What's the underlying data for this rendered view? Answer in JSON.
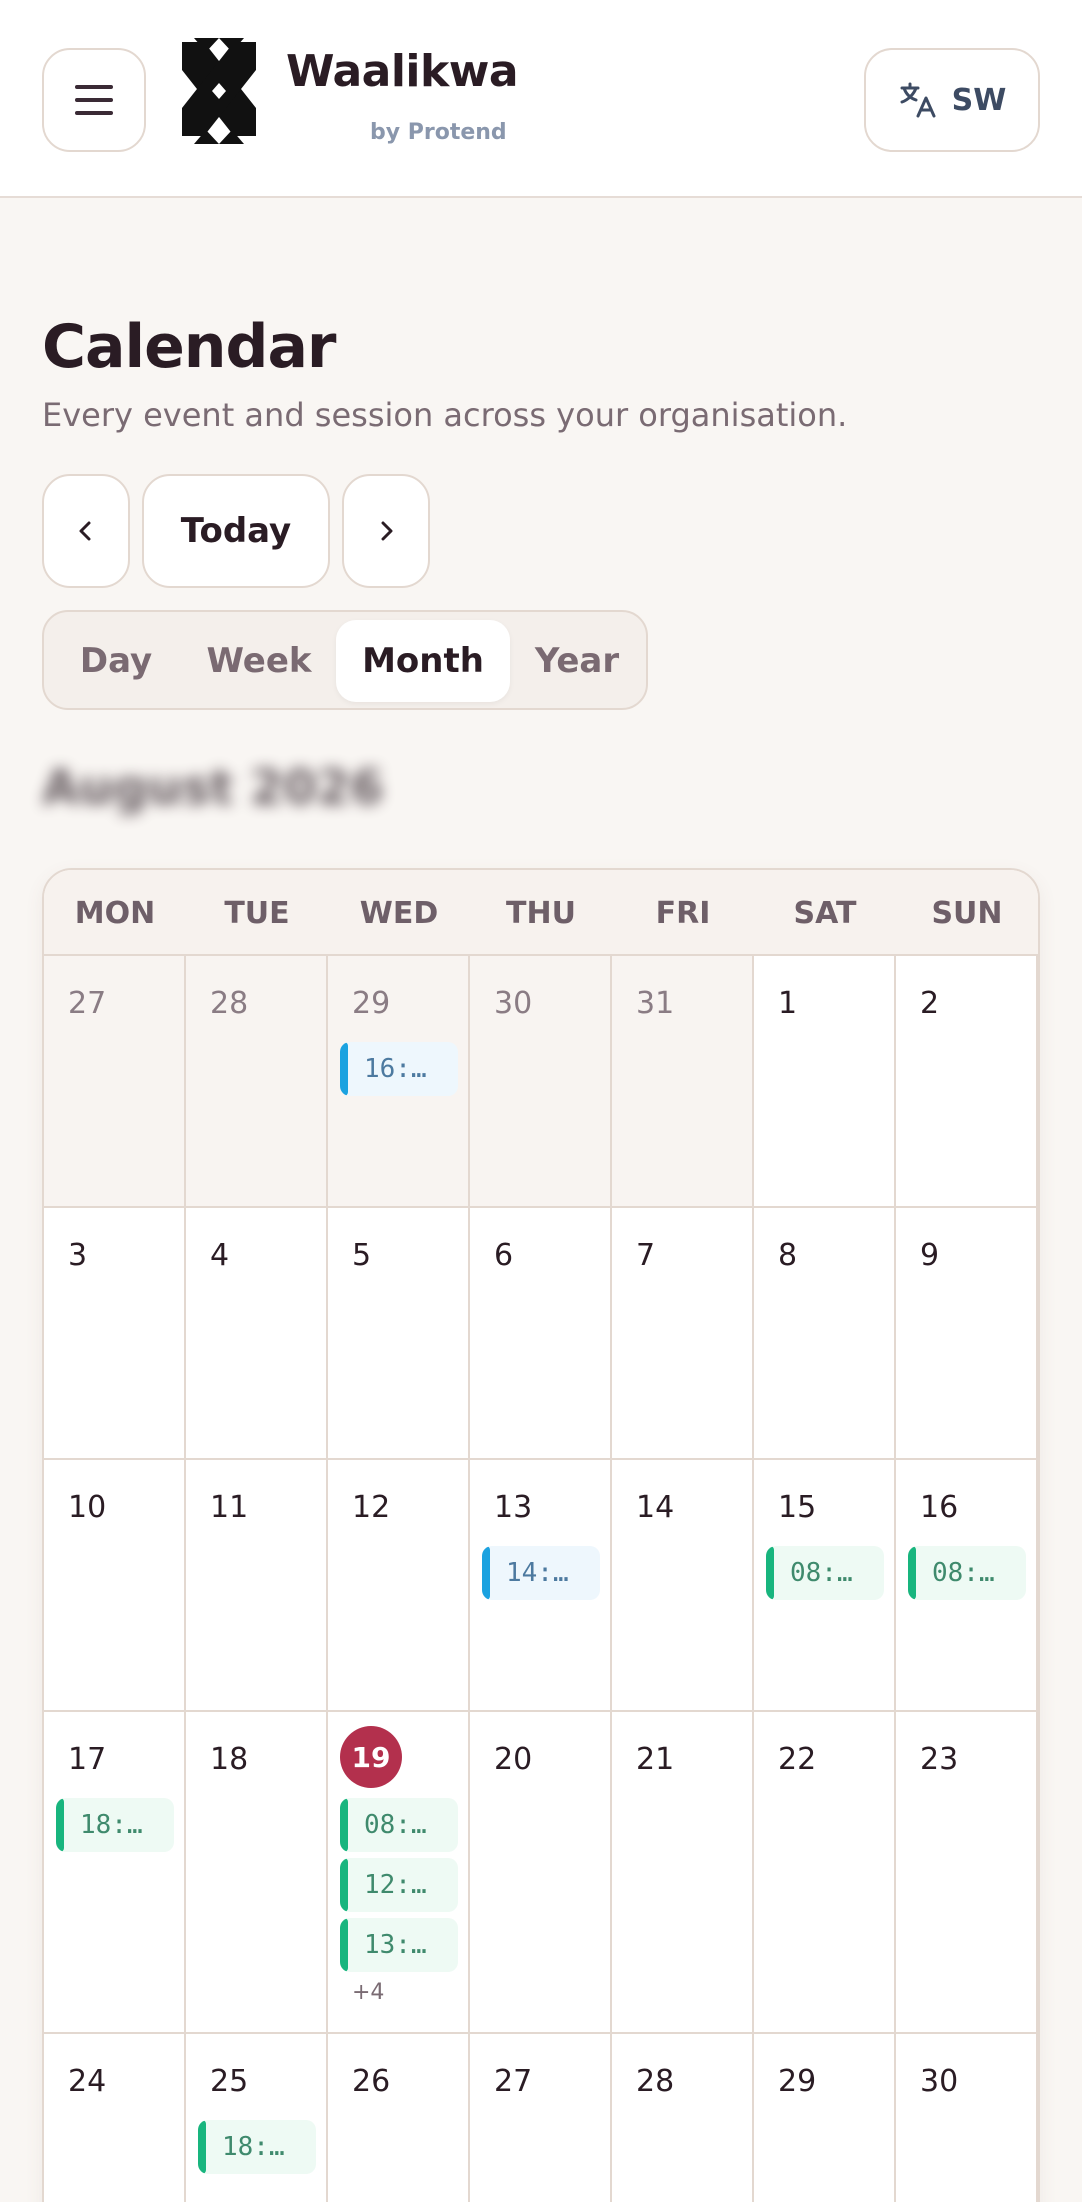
{
  "header": {
    "brand": "Waalikwa",
    "brand_sub": "by Protend",
    "lang_code": "SW"
  },
  "page": {
    "title": "Calendar",
    "subtitle": "Every event and session across your organisation.",
    "today_label": "Today",
    "month_label": "August 2026"
  },
  "views": [
    "Day",
    "Week",
    "Month",
    "Year"
  ],
  "active_view": "Month",
  "weekdays": [
    "MON",
    "TUE",
    "WED",
    "THU",
    "FRI",
    "SAT",
    "SUN"
  ],
  "weeks": [
    [
      {
        "day": "27",
        "muted": true,
        "events": []
      },
      {
        "day": "28",
        "muted": true,
        "events": []
      },
      {
        "day": "29",
        "muted": true,
        "events": [
          {
            "label": "16:…",
            "color": "blue"
          }
        ]
      },
      {
        "day": "30",
        "muted": true,
        "events": []
      },
      {
        "day": "31",
        "muted": true,
        "events": []
      },
      {
        "day": "1",
        "muted": false,
        "events": []
      },
      {
        "day": "2",
        "muted": false,
        "events": []
      }
    ],
    [
      {
        "day": "3",
        "muted": false,
        "events": []
      },
      {
        "day": "4",
        "muted": false,
        "events": []
      },
      {
        "day": "5",
        "muted": false,
        "events": []
      },
      {
        "day": "6",
        "muted": false,
        "events": []
      },
      {
        "day": "7",
        "muted": false,
        "events": []
      },
      {
        "day": "8",
        "muted": false,
        "events": []
      },
      {
        "day": "9",
        "muted": false,
        "events": []
      }
    ],
    [
      {
        "day": "10",
        "muted": false,
        "events": []
      },
      {
        "day": "11",
        "muted": false,
        "events": []
      },
      {
        "day": "12",
        "muted": false,
        "events": []
      },
      {
        "day": "13",
        "muted": false,
        "events": [
          {
            "label": "14:…",
            "color": "blue"
          }
        ]
      },
      {
        "day": "14",
        "muted": false,
        "events": []
      },
      {
        "day": "15",
        "muted": false,
        "events": [
          {
            "label": "08:…",
            "color": "green"
          }
        ]
      },
      {
        "day": "16",
        "muted": false,
        "events": [
          {
            "label": "08:…",
            "color": "green"
          }
        ]
      }
    ],
    [
      {
        "day": "17",
        "muted": false,
        "events": [
          {
            "label": "18:…",
            "color": "green"
          }
        ]
      },
      {
        "day": "18",
        "muted": false,
        "events": []
      },
      {
        "day": "19",
        "muted": false,
        "today": true,
        "events": [
          {
            "label": "08:…",
            "color": "green"
          },
          {
            "label": "12:…",
            "color": "green"
          },
          {
            "label": "13:…",
            "color": "green"
          }
        ],
        "more": "+4"
      },
      {
        "day": "20",
        "muted": false,
        "events": []
      },
      {
        "day": "21",
        "muted": false,
        "events": []
      },
      {
        "day": "22",
        "muted": false,
        "events": []
      },
      {
        "day": "23",
        "muted": false,
        "events": []
      }
    ],
    [
      {
        "day": "24",
        "muted": false,
        "events": []
      },
      {
        "day": "25",
        "muted": false,
        "events": [
          {
            "label": "18:…",
            "color": "green"
          }
        ]
      },
      {
        "day": "26",
        "muted": false,
        "events": []
      },
      {
        "day": "27",
        "muted": false,
        "events": []
      },
      {
        "day": "28",
        "muted": false,
        "events": []
      },
      {
        "day": "29",
        "muted": false,
        "events": []
      },
      {
        "day": "30",
        "muted": false,
        "events": []
      }
    ]
  ],
  "icons": {
    "menu": "menu-icon",
    "logo": "waalikwa-logo",
    "translate": "translate-icon",
    "prev": "chevron-left-icon",
    "next": "chevron-right-icon"
  },
  "colors": {
    "accent_today": "#b3304d",
    "event_blue": "#1ba2e0",
    "event_green": "#18b57e",
    "background": "#f9f6f3"
  }
}
